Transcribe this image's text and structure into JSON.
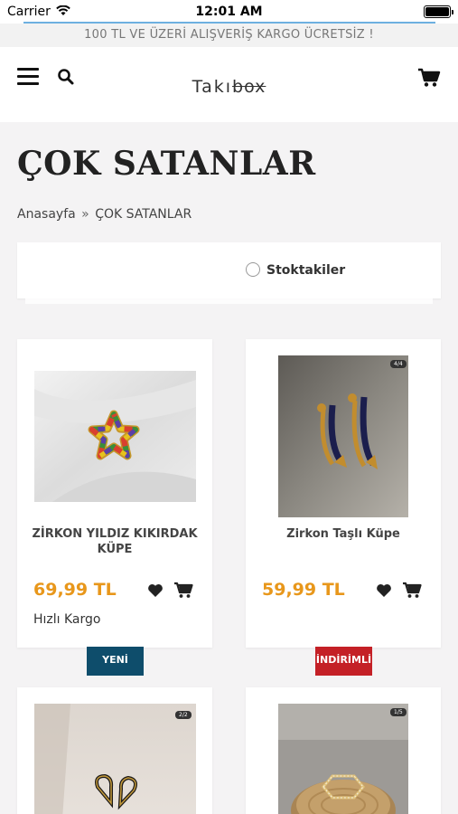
{
  "status_bar": {
    "carrier": "Carrier",
    "time": "12:01 AM"
  },
  "promo": {
    "text": "100 TL VE ÜZERİ ALIŞVERİŞ KARGO ÜCRETSİZ !"
  },
  "header": {
    "logo_part1": "Takı",
    "logo_part2": "box",
    "menu_icon": "hamburger-icon",
    "search_icon": "search-icon",
    "cart_icon": "cart-icon"
  },
  "page": {
    "title": "ÇOK SATANLAR",
    "breadcrumb": {
      "home": "Anasayfa",
      "separator": "»",
      "current": "ÇOK SATANLAR"
    }
  },
  "filter": {
    "in_stock_label": "Stoktakiler",
    "in_stock_checked": false
  },
  "products": [
    {
      "name": "ZİRKON YILDIZ KIKIRDAK KÜPE",
      "price": "69,99 TL",
      "shipping": "Hızlı Kargo",
      "ribbon": "YENİ",
      "image_badge": ""
    },
    {
      "name": "Zirkon Taşlı Küpe",
      "price": "59,99 TL",
      "shipping": "",
      "ribbon": "İNDİRİMLİ",
      "image_badge": "4/4"
    },
    {
      "name": "",
      "price": "",
      "shipping": "",
      "ribbon": "",
      "image_badge": "2/2"
    },
    {
      "name": "",
      "price": "",
      "shipping": "",
      "ribbon": "",
      "image_badge": "1/5"
    }
  ],
  "colors": {
    "price": "#e8971b",
    "ribbon_new": "#0e4d6b",
    "ribbon_discount": "#c42026"
  }
}
